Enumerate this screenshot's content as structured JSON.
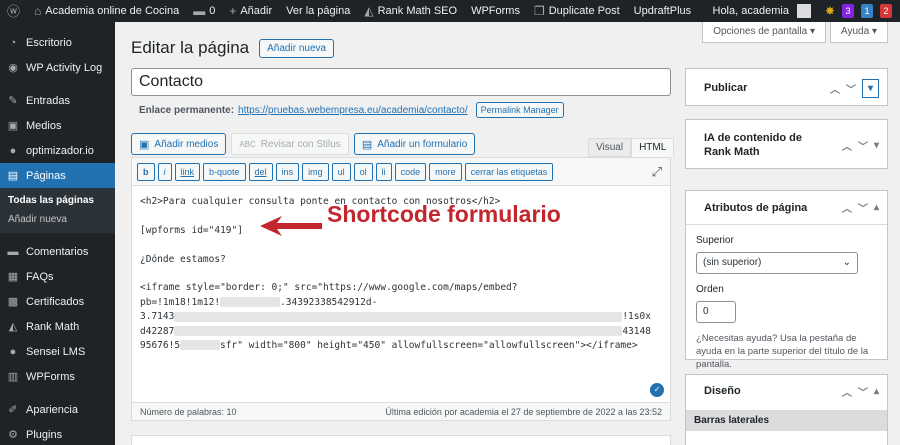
{
  "adminbar": {
    "site_name": "Academia online de Cocina",
    "comments_count": "0",
    "new_label": "Añadir",
    "view_page": "Ver la página",
    "rankmath": "Rank Math SEO",
    "wpforms": "WPForms",
    "duplicate": "Duplicate Post",
    "updraft": "UpdraftPlus",
    "greeting": "Hola, academia",
    "badges": [
      {
        "text": "3",
        "color": "#8224e3"
      },
      {
        "text": "1",
        "color": "#3582c4"
      },
      {
        "text": "2",
        "color": "#d63638"
      }
    ]
  },
  "sidebar": {
    "items": [
      {
        "label": "Escritorio",
        "icon": "dashboard-icon",
        "glyph": "◔"
      },
      {
        "label": "WP Activity Log",
        "icon": "activity-log-icon",
        "glyph": "◉"
      },
      {
        "label": "Entradas",
        "icon": "pin-icon",
        "glyph": "✎"
      },
      {
        "label": "Medios",
        "icon": "media-icon",
        "glyph": "▣"
      },
      {
        "label": "optimizador.io",
        "icon": "optimizer-icon",
        "glyph": "●"
      },
      {
        "label": "Páginas",
        "icon": "pages-icon",
        "glyph": "▤"
      },
      {
        "label": "Comentarios",
        "icon": "comments-icon",
        "glyph": "▬"
      },
      {
        "label": "FAQs",
        "icon": "faqs-icon",
        "glyph": "▦"
      },
      {
        "label": "Certificados",
        "icon": "certificates-icon",
        "glyph": "▩"
      },
      {
        "label": "Rank Math",
        "icon": "rank-math-icon",
        "glyph": "◭"
      },
      {
        "label": "Sensei LMS",
        "icon": "sensei-icon",
        "glyph": "●"
      },
      {
        "label": "WPForms",
        "icon": "wpforms-icon",
        "glyph": "▥"
      },
      {
        "label": "Apariencia",
        "icon": "appearance-icon",
        "glyph": "✐"
      },
      {
        "label": "Plugins",
        "icon": "plugins-icon",
        "glyph": "⚙"
      }
    ],
    "submenu": [
      "Todas las páginas",
      "Añadir nueva"
    ]
  },
  "screen_options": "Opciones de pantalla",
  "help": "Ayuda",
  "page_title": "Editar la página",
  "add_new": "Añadir nueva",
  "post_title": "Contacto",
  "permalink": {
    "label": "Enlace permanente:",
    "url": "https://pruebas.webempresa.eu/academia/contacto/",
    "manager": "Permalink Manager"
  },
  "media_buttons": {
    "add_media": "Añadir medios",
    "review": "Revisar con Stilus",
    "add_form": "Añadir un formulario"
  },
  "editor_tabs": {
    "visual": "Visual",
    "html": "HTML"
  },
  "quicktags": [
    "b",
    "i",
    "link",
    "b-quote",
    "del",
    "ins",
    "img",
    "ul",
    "ol",
    "li",
    "code",
    "more",
    "cerrar las etiquetas"
  ],
  "code": {
    "line1": "<h2>Para cualquier consulta ponte en contacto con nosotros</h2>",
    "line2": "[wpforms id=\"419\"]",
    "line3": "¿Dónde estamos?",
    "line4": "<iframe style=\"border: 0;\" src=\"https://www.google.com/maps/embed?",
    "line5a": "pb=!1m18!1m12!",
    "line5b": ".34392338542912d-",
    "line6a": "3.7143",
    "line6b": "!1s0x",
    "line7a": "d42287",
    "line7b": "43148",
    "line8a": "95676!5",
    "line8b": "sfr\" width=\"800\" height=\"450\" allowfullscreen=\"allowfullscreen\"></iframe>"
  },
  "annotation": "Shortcode formulario",
  "status": {
    "word_count": "Número de palabras: 10",
    "last_edit": "Última edición por academia el 27 de septiembre de 2022 a las 23:52"
  },
  "boxes": {
    "publish": "Publicar",
    "ai_title": "IA de contenido de Rank Math",
    "attrs_title": "Atributos de página",
    "parent_label": "Superior",
    "parent_value": "(sin superior)",
    "order_label": "Orden",
    "order_value": "0",
    "help_text": "¿Necesitas ayuda? Usa la pestaña de ayuda en la parte superior del título de la pantalla.",
    "design_title": "Diseño",
    "sidebars_label": "Barras laterales"
  }
}
